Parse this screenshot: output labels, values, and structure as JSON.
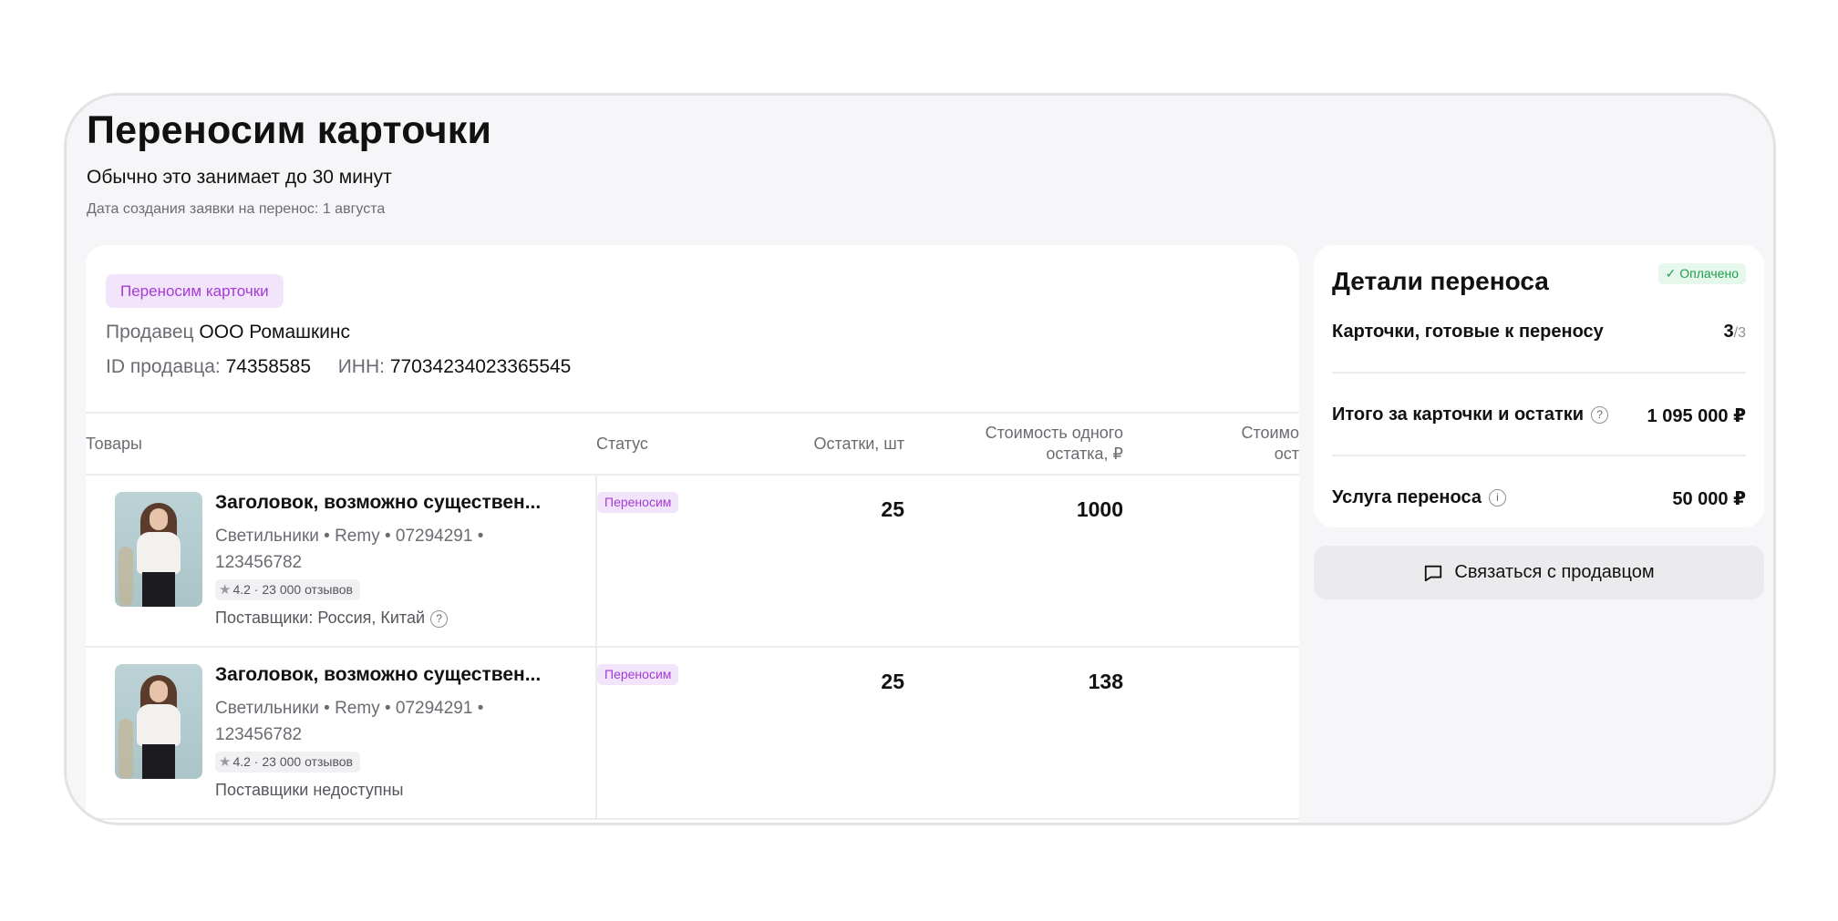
{
  "header": {
    "title": "Переносим карточки",
    "subtitle": "Обычно это занимает до 30 минут",
    "created": "Дата создания заявки на перенос: 1 августа"
  },
  "transfer": {
    "status_tag": "Переносим карточки",
    "seller_label": "Продавец",
    "seller_name": "ООО Ромашкинс",
    "id_label": "ID продавца:",
    "id_value": "74358585",
    "inn_label": "ИНН:",
    "inn_value": "77034234023365545"
  },
  "table": {
    "headers": {
      "goods": "Товары",
      "status": "Статус",
      "stock": "Остатки, шт",
      "unit_price_line1": "Стоимость одного",
      "unit_price_line2": "остатка, ₽",
      "more_line1": "Стоимо",
      "more_line2": "ост"
    },
    "rows": [
      {
        "title": "Заголовок, возможно существен...",
        "category_line": "Светильники • Remy • 07294291 •",
        "article": "123456782",
        "rating": "4.2 · 23 000 отзывов",
        "suppliers": "Поставщики: Россия, Китай",
        "suppliers_help": true,
        "status": "Переносим",
        "stock": "25",
        "unit_price": "1000"
      },
      {
        "title": "Заголовок, возможно существен...",
        "category_line": "Светильники • Remy • 07294291 •",
        "article": "123456782",
        "rating": "4.2 · 23 000 отзывов",
        "suppliers": "Поставщики недоступны",
        "suppliers_help": false,
        "status": "Переносим",
        "stock": "25",
        "unit_price": "138"
      }
    ]
  },
  "details": {
    "title": "Детали переноса",
    "paid_badge": "✓ Оплачено",
    "ready_label": "Карточки, готовые к переносу",
    "ready_count": "3",
    "ready_total": "/3",
    "total_label": "Итого за карточки и остатки",
    "total_value": "1 095 000 ₽",
    "service_label": "Услуга переноса",
    "service_value": "50 000 ₽"
  },
  "contact_button": "Связаться с продавцом",
  "colors": {
    "accent_purple": "#a33bd4",
    "tag_bg": "#f2e4fb",
    "paid_green": "#1f9d4c"
  },
  "icons": [
    "help-icon",
    "info-icon",
    "star-icon",
    "chat-icon",
    "check-icon"
  ]
}
